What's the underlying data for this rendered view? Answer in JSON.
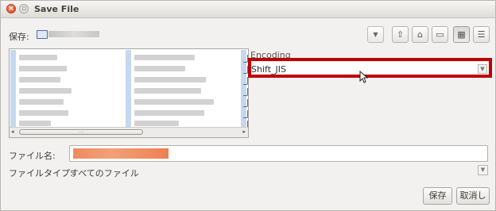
{
  "window": {
    "title": "Save File"
  },
  "location": {
    "label": "保存:"
  },
  "encoding": {
    "label": "Encoding",
    "value": "Shift_JIS"
  },
  "filename": {
    "label": "ファイル名:"
  },
  "filetype": {
    "label": "ファイルタイプ:",
    "value": "すべてのファイル"
  },
  "buttons": {
    "save": "保存",
    "cancel": "取消し"
  },
  "colors": {
    "highlight_border": "#c00000",
    "selection": "#f08a5f"
  }
}
